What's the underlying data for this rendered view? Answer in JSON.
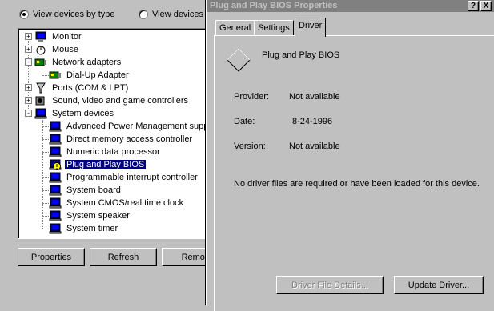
{
  "device_manager": {
    "view_by_type_label": "View devices by type",
    "view_by_connection_label": "View devices",
    "tree": [
      {
        "label": "Monitor",
        "icon": "monitor-icon",
        "level": 0,
        "expander": "+"
      },
      {
        "label": "Mouse",
        "icon": "mouse-icon",
        "level": 0,
        "expander": "+"
      },
      {
        "label": "Network adapters",
        "icon": "network-adapter-icon",
        "level": 0,
        "expander": "-"
      },
      {
        "label": "Dial-Up Adapter",
        "icon": "network-adapter-icon",
        "level": 1
      },
      {
        "label": "Ports (COM & LPT)",
        "icon": "port-icon",
        "level": 0,
        "expander": "+"
      },
      {
        "label": "Sound, video and game controllers",
        "icon": "sound-icon",
        "level": 0,
        "expander": "+"
      },
      {
        "label": "System devices",
        "icon": "computer-icon",
        "level": 0,
        "expander": "-"
      },
      {
        "label": "Advanced Power Management supp",
        "icon": "computer-icon",
        "level": 1
      },
      {
        "label": "Direct memory access controller",
        "icon": "computer-icon",
        "level": 1
      },
      {
        "label": "Numeric data processor",
        "icon": "computer-icon",
        "level": 1
      },
      {
        "label": "Plug and Play BIOS",
        "icon": "warning-computer-icon",
        "level": 1,
        "selected": true
      },
      {
        "label": "Programmable interrupt controller",
        "icon": "computer-icon",
        "level": 1
      },
      {
        "label": "System board",
        "icon": "computer-icon",
        "level": 1
      },
      {
        "label": "System CMOS/real time clock",
        "icon": "computer-icon",
        "level": 1
      },
      {
        "label": "System speaker",
        "icon": "computer-icon",
        "level": 1
      },
      {
        "label": "System timer",
        "icon": "computer-icon",
        "level": 1
      }
    ],
    "buttons": {
      "properties": "Properties",
      "refresh": "Refresh",
      "remove": "Remov"
    }
  },
  "properties_dialog": {
    "title": "Plug and Play BIOS Properties",
    "help_button": "?",
    "close_button": "X",
    "tabs": [
      {
        "label": "General",
        "active": false
      },
      {
        "label": "Settings",
        "active": false
      },
      {
        "label": "Driver",
        "active": true
      }
    ],
    "device_name": "Plug and Play BIOS",
    "provider_label": "Provider:",
    "provider_value": "Not available",
    "date_label": "Date:",
    "date_value": "8-24-1996",
    "version_label": "Version:",
    "version_value": "Not available",
    "message": "No driver files are required or have been loaded for this device.",
    "driver_file_details_button": "Driver File Details...",
    "update_driver_button": "Update Driver..."
  }
}
